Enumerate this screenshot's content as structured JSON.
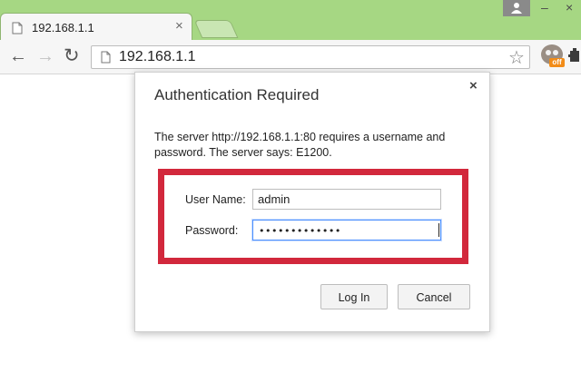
{
  "browser": {
    "tab": {
      "title": "192.168.1.1",
      "close_glyph": "×"
    },
    "window_controls": {
      "minimize_glyph": "–",
      "close_glyph": "×"
    },
    "toolbar": {
      "back_glyph": "←",
      "forward_glyph": "→",
      "reload_glyph": "↻",
      "address": "192.168.1.1",
      "star_glyph": "☆"
    },
    "extensions": {
      "badge_text": "off"
    }
  },
  "dialog": {
    "title": "Authentication Required",
    "close_glyph": "×",
    "message": "The server http://192.168.1.1:80 requires a username and password. The server says: E1200.",
    "username_label": "User Name:",
    "username_value": "admin",
    "password_label": "Password:",
    "password_mask": "•••••••••••••",
    "login_label": "Log In",
    "cancel_label": "Cancel",
    "highlight_color": "#d2283c"
  },
  "colors": {
    "tabstrip_bg": "#a6d783",
    "focus_border": "#4d90fe"
  }
}
